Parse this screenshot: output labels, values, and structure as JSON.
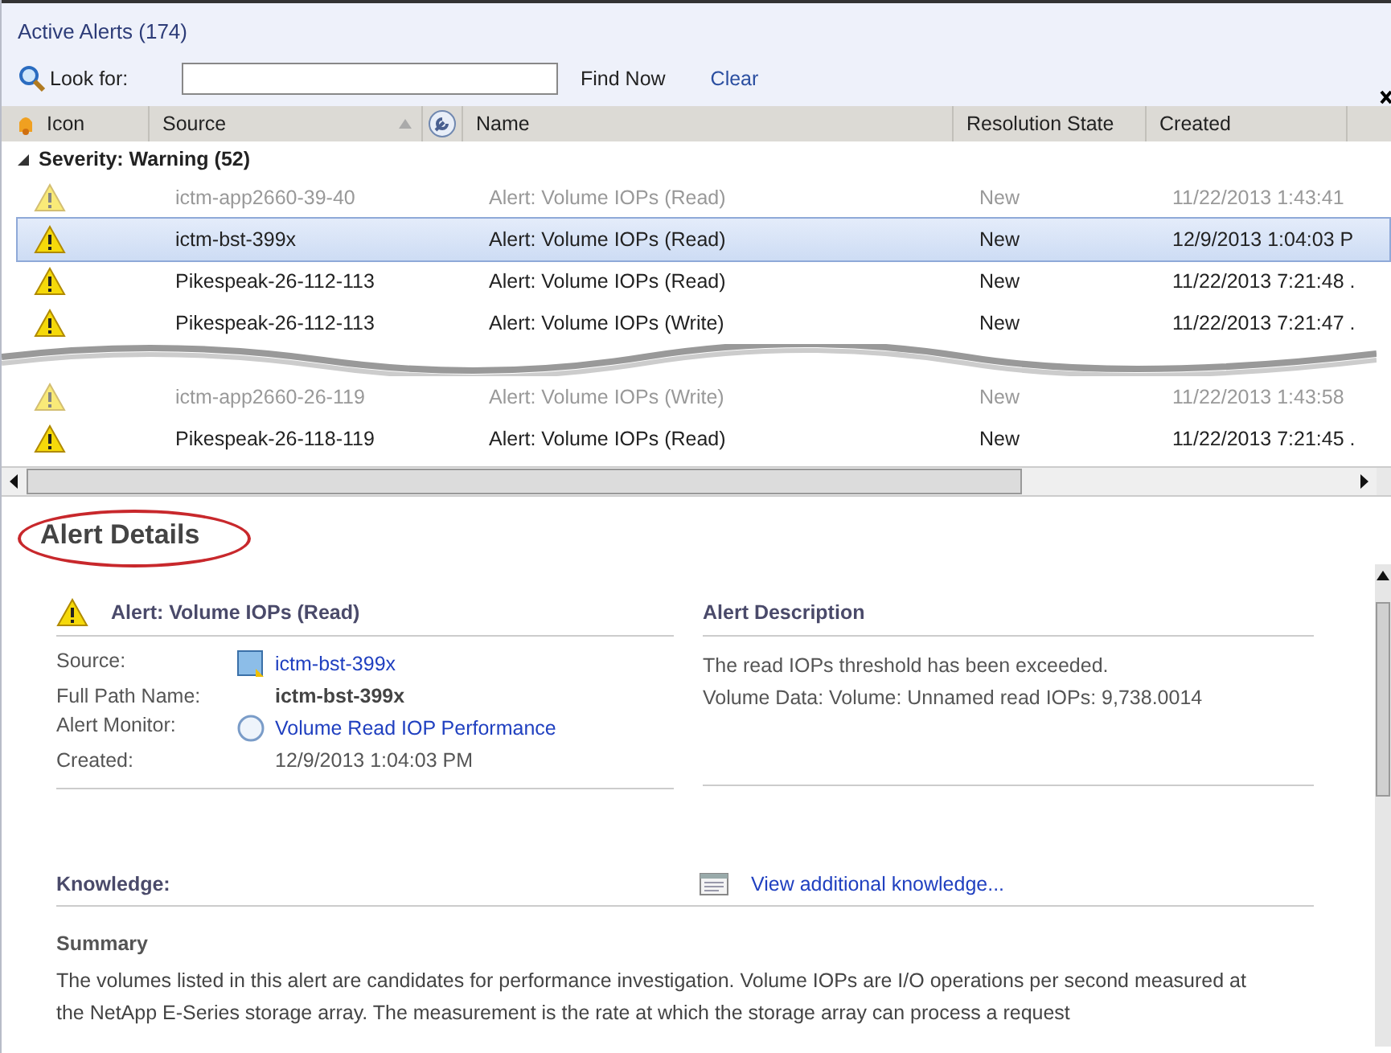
{
  "alerts": {
    "title": "Active Alerts (174)",
    "search_label": "Look for:",
    "find_button": "Find Now",
    "clear_link": "Clear",
    "columns": [
      {
        "label": "Icon",
        "kind": "icon-text",
        "sorted": false
      },
      {
        "label": "Source",
        "kind": "text",
        "sorted": true
      },
      {
        "kind": "wrench",
        "sorted": false
      },
      {
        "label": "Name",
        "kind": "text",
        "sorted": false
      },
      {
        "label": "Resolution State",
        "kind": "text",
        "sorted": false
      },
      {
        "label": "Created",
        "kind": "text",
        "sorted": false
      }
    ],
    "group": {
      "label": "Severity: Warning (52)",
      "expanded": true
    },
    "rows": [
      {
        "source": "ictm-app2660-39-40",
        "name": "Alert: Volume IOPs (Read)",
        "state": "New",
        "created": "11/22/2013 1:43:41",
        "selected": false,
        "faded": true
      },
      {
        "source": "ictm-bst-399x",
        "name": "Alert: Volume IOPs (Read)",
        "state": "New",
        "created": "12/9/2013 1:04:03 P",
        "selected": true,
        "faded": false
      },
      {
        "source": "Pikespeak-26-112-113",
        "name": "Alert: Volume IOPs (Read)",
        "state": "New",
        "created": "11/22/2013 7:21:48 .",
        "selected": false,
        "faded": false
      },
      {
        "source": "Pikespeak-26-112-113",
        "name": "Alert: Volume IOPs (Write)",
        "state": "New",
        "created": "11/22/2013 7:21:47 .",
        "selected": false,
        "faded": false
      },
      {
        "kind": "tear"
      },
      {
        "source": "ictm-app2660-26-119",
        "name": "Alert: Volume IOPs (Write)",
        "state": "New",
        "created": "11/22/2013 1:43:58",
        "selected": false,
        "faded": true
      },
      {
        "source": "Pikespeak-26-118-119",
        "name": "Alert: Volume IOPs (Read)",
        "state": "New",
        "created": "11/22/2013 7:21:45 .",
        "selected": false,
        "faded": false
      }
    ]
  },
  "details": {
    "title": "Alert Details",
    "alert_title": "Alert: Volume IOPs (Read)",
    "description_heading": "Alert Description",
    "fields": [
      {
        "label": "Source:",
        "value": "ictm-bst-399x",
        "kind": "computer-link"
      },
      {
        "label": "Full Path Name:",
        "value": "ictm-bst-399x",
        "kind": "bold"
      },
      {
        "label": "Alert Monitor:",
        "value": "Volume Read IOP Performance",
        "kind": "monitor-link"
      },
      {
        "label": "Created:",
        "value": "12/9/2013 1:04:03 PM",
        "kind": "plain"
      }
    ],
    "description": [
      "The read IOPs threshold has been exceeded.",
      "Volume Data: Volume: Unnamed read IOPs: 9,738.0014"
    ],
    "knowledge_label": "Knowledge:",
    "knowledge_link": "View additional knowledge...",
    "summary_heading": "Summary",
    "summary": "The volumes listed in this alert are candidates for performance investigation. Volume IOPs are I/O operations per second measured at the NetApp E-Series storage array. The measurement is the rate at which the storage array can process a request"
  }
}
